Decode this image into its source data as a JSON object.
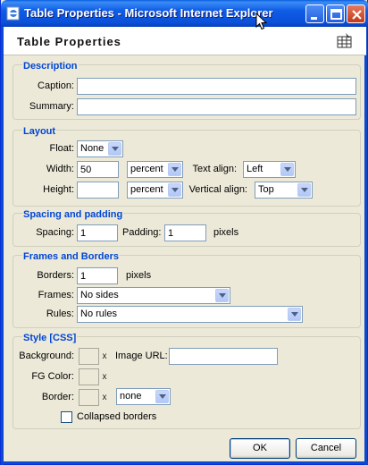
{
  "window": {
    "title": "Table Properties - Microsoft Internet Explorer",
    "controls": [
      "minimize",
      "maximize",
      "close"
    ]
  },
  "dialog": {
    "title": "Table Properties"
  },
  "description": {
    "legend": "Description",
    "caption_label": "Caption:",
    "caption_value": "",
    "summary_label": "Summary:",
    "summary_value": ""
  },
  "layout": {
    "legend": "Layout",
    "float_label": "Float:",
    "float_value": "None",
    "width_label": "Width:",
    "width_value": "50",
    "width_unit": "percent",
    "text_align_label": "Text align:",
    "text_align_value": "Left",
    "height_label": "Height:",
    "height_value": "",
    "height_unit": "percent",
    "vertical_align_label": "Vertical align:",
    "vertical_align_value": "Top"
  },
  "spacing": {
    "legend": "Spacing and padding",
    "spacing_label": "Spacing:",
    "spacing_value": "1",
    "padding_label": "Padding:",
    "padding_value": "1",
    "unit": "pixels"
  },
  "frames": {
    "legend": "Frames and Borders",
    "borders_label": "Borders:",
    "borders_value": "1",
    "borders_unit": "pixels",
    "frames_label": "Frames:",
    "frames_value": "No sides",
    "rules_label": "Rules:",
    "rules_value": "No rules"
  },
  "style": {
    "legend": "Style [CSS]",
    "background_label": "Background:",
    "image_url_label": "Image URL:",
    "image_url_value": "",
    "fg_color_label": "FG Color:",
    "border_label": "Border:",
    "border_style_value": "none",
    "clear_glyph": "x",
    "collapsed_label": "Collapsed borders",
    "collapsed_checked": false
  },
  "buttons": {
    "ok": "OK",
    "cancel": "Cancel"
  },
  "colors": {
    "accent": "#0046D5",
    "titlebar": "#0A5FE0",
    "face": "#ECE9D8"
  }
}
